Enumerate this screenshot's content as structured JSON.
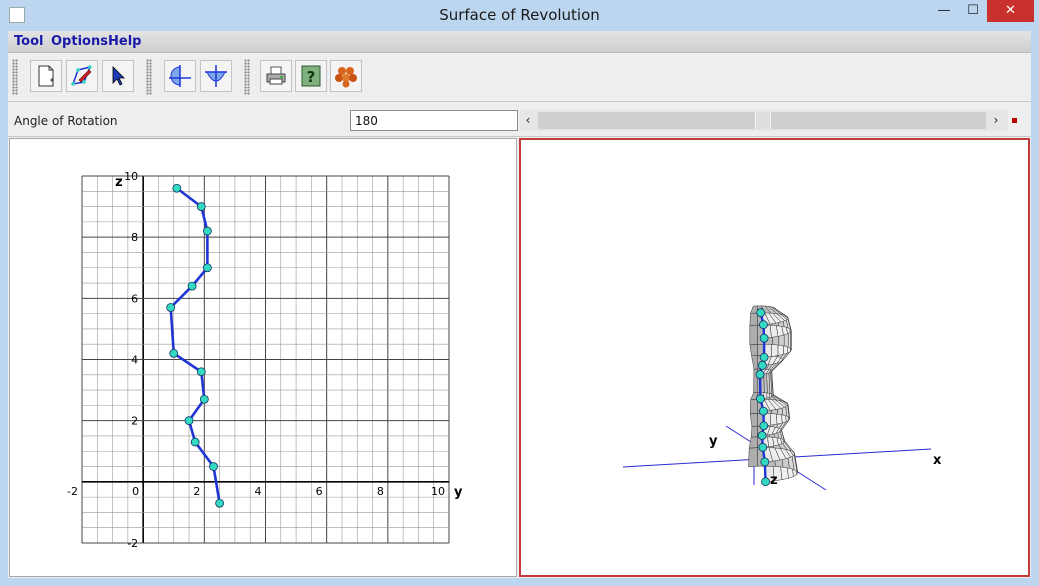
{
  "window": {
    "title": "Surface of Revolution",
    "controls": {
      "minimize": "—",
      "maximize": "☐",
      "close": "✕"
    }
  },
  "menu": [
    "Tool",
    "Options",
    "Help"
  ],
  "toolbar": {
    "buttons": [
      {
        "name": "new-document-button",
        "icon": "new-document-icon"
      },
      {
        "name": "draw-polyline-button",
        "icon": "pencil-icon"
      },
      {
        "name": "select-button",
        "icon": "arrow-cursor-icon"
      },
      {
        "name": "rotate-half-button",
        "icon": "half-surface-icon"
      },
      {
        "name": "rotate-full-button",
        "icon": "full-surface-icon"
      },
      {
        "name": "print-button",
        "icon": "printer-icon"
      },
      {
        "name": "help-button",
        "icon": "question-icon"
      },
      {
        "name": "render-button",
        "icon": "spheres-icon"
      }
    ]
  },
  "angle": {
    "label": "Angle of Rotation",
    "value": "180",
    "slider_fraction": 0.5,
    "left_arrow": "‹",
    "right_arrow": "›"
  },
  "profile_plot": {
    "y_axis_label": "y",
    "z_axis_label": "z",
    "y_ticks": [
      "-2",
      "0",
      "2",
      "4",
      "6",
      "8",
      "10"
    ],
    "z_ticks": [
      "-2",
      "0",
      "2",
      "4",
      "6",
      "8",
      "10"
    ],
    "y_range": [
      -2,
      10
    ],
    "z_range": [
      -2,
      10
    ],
    "curve_color": "#1f35d6",
    "point_color": "#33d9c0",
    "points": [
      [
        2.5,
        -0.7
      ],
      [
        2.3,
        0.5
      ],
      [
        1.7,
        1.3
      ],
      [
        1.5,
        2.0
      ],
      [
        2.0,
        2.7
      ],
      [
        1.9,
        3.6
      ],
      [
        1.0,
        4.2
      ],
      [
        0.9,
        5.7
      ],
      [
        1.6,
        6.4
      ],
      [
        2.1,
        7.0
      ],
      [
        2.1,
        8.2
      ],
      [
        1.9,
        9.0
      ],
      [
        1.1,
        9.6
      ]
    ]
  },
  "surface_view": {
    "x_label": "x",
    "y_label": "y",
    "z_label": "z"
  }
}
